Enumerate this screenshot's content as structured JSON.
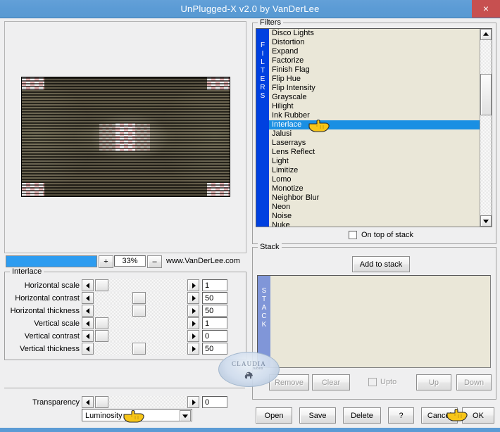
{
  "window": {
    "title": "UnPlugged-X v2.0 by VanDerLee",
    "close_label": "×",
    "titlebar_color": "#5b9bd5",
    "close_color": "#c75050"
  },
  "preview": {
    "zoom_label": "33%",
    "zoom_in_label": "+",
    "zoom_out_label": "–",
    "website": "www.VanDerLee.com",
    "progress_color": "#2d9cf0"
  },
  "filters_panel": {
    "legend": "Filters",
    "sidebar_label": "FILTERS",
    "sidebar_color": "#0040e0",
    "selection_color": "#1a8fe3",
    "selected": "Interlace",
    "items": [
      "Disco Lights",
      "Distortion",
      "Expand",
      "Factorize",
      "Finish Flag",
      "Flip Hue",
      "Flip Intensity",
      "Grayscale",
      "Hilight",
      "Ink Rubber",
      "Interlace",
      "Jalusi",
      "Laserrays",
      "Lens Reflect",
      "Light",
      "Limitize",
      "Lomo",
      "Monotize",
      "Neighbor Blur",
      "Neon",
      "Noise",
      "Nuke"
    ],
    "on_top_of_stack": {
      "label": "On top of stack",
      "checked": false
    }
  },
  "interlace_panel": {
    "legend": "Interlace",
    "rows": [
      {
        "label": "Horizontal scale",
        "value": "1",
        "thumb_pct": 2
      },
      {
        "label": "Horizontal contrast",
        "value": "50",
        "thumb_pct": 49
      },
      {
        "label": "Horizontal thickness",
        "value": "50",
        "thumb_pct": 49
      },
      {
        "label": "Vertical scale",
        "value": "1",
        "thumb_pct": 2
      },
      {
        "label": "Vertical contrast",
        "value": "0",
        "thumb_pct": 2
      },
      {
        "label": "Vertical thickness",
        "value": "50",
        "thumb_pct": 49
      }
    ]
  },
  "transparency": {
    "label": "Transparency",
    "value": "0",
    "thumb_pct": 2,
    "blend_mode": "Luminosity"
  },
  "stack_panel": {
    "legend": "Stack",
    "sidebar_label": "STACK",
    "sidebar_color": "#8096d8",
    "add_button": "Add to stack",
    "items": [],
    "controls": {
      "remove": "Remove",
      "clear": "Clear",
      "upto": "Upto",
      "upto_checked": false,
      "up": "Up",
      "down": "Down"
    }
  },
  "dialog_buttons": {
    "open": "Open",
    "save": "Save",
    "delete": "Delete",
    "help": "?",
    "cancel": "Cancel",
    "ok": "OK"
  },
  "watermark": {
    "text": "CLAUDIA",
    "subtext": "tubes"
  }
}
